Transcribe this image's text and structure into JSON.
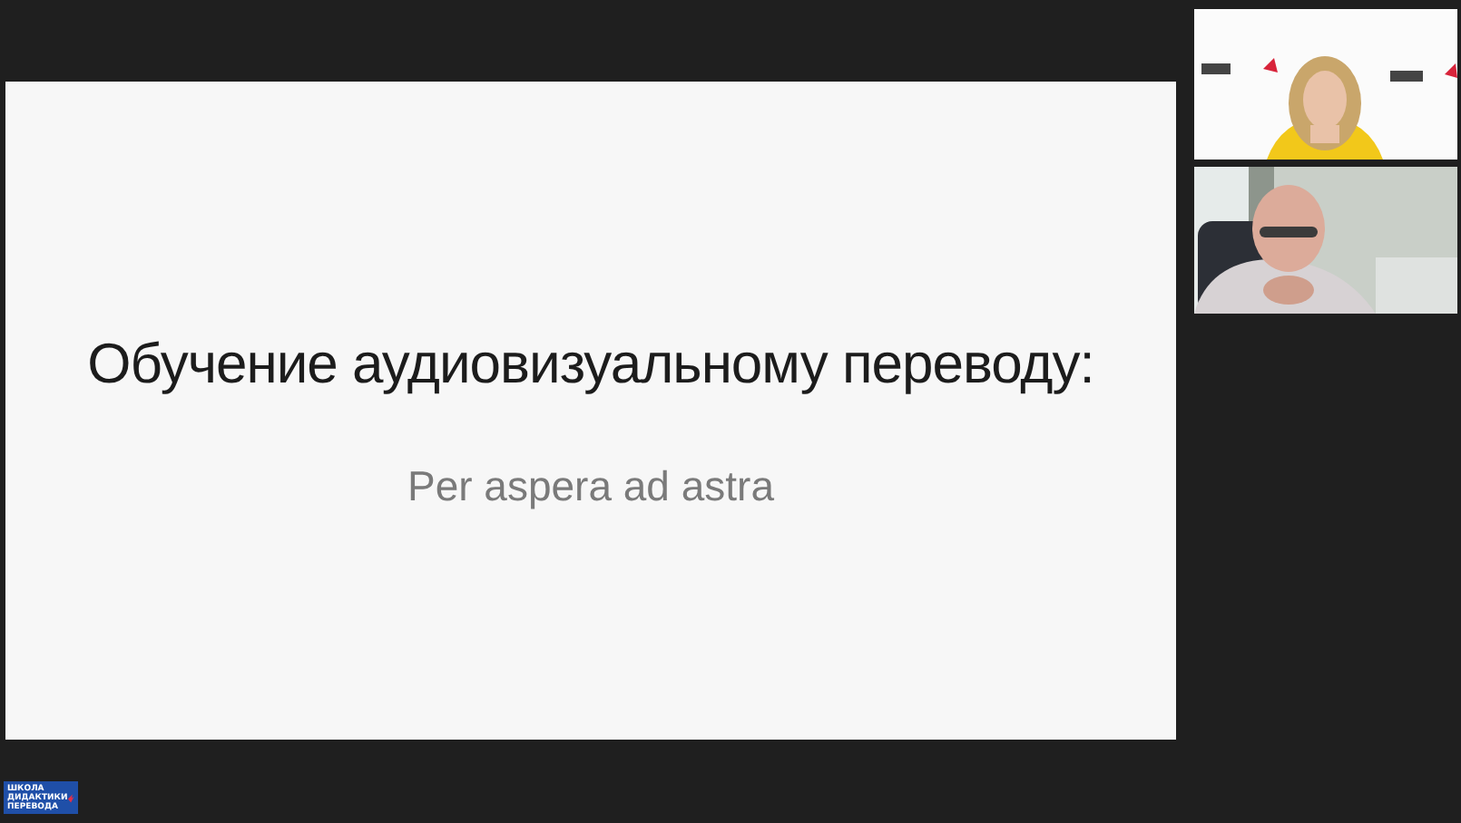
{
  "slide": {
    "title": "Обучение аудиовизуальному переводу:",
    "subtitle": "Per aspera ad astra"
  },
  "logo": {
    "lines": [
      "ШКОЛА",
      "ДИДАКТИКИ",
      "ПЕРЕВОДА"
    ]
  }
}
